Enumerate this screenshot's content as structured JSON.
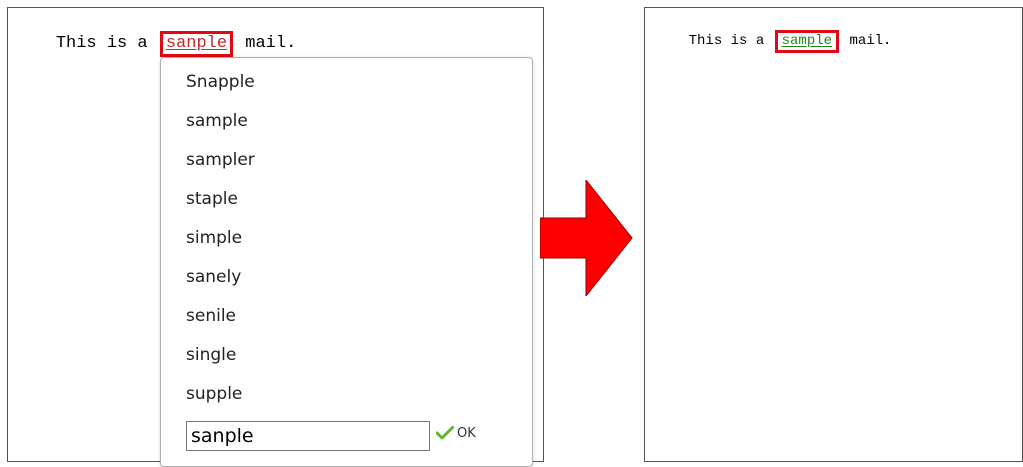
{
  "left_editor": {
    "text_before": "This is a",
    "misspelled_word": "sanple",
    "text_after": "mail."
  },
  "spellcheck_popup": {
    "suggestions": [
      "Snapple",
      "sample",
      "sampler",
      "staple",
      "simple",
      "sanely",
      "senile",
      "single",
      "supple"
    ],
    "edit_value": "sanple",
    "ok_label": "OK",
    "ok_icon": "checkmark-icon"
  },
  "right_editor": {
    "text_before": "This is a",
    "corrected_word": "sample",
    "text_after": "mail."
  },
  "colors": {
    "highlight_box": "#e30613",
    "arrow": "#ff0000",
    "misspelled_text": "#c0282e",
    "corrected_text": "#1a8a1a",
    "checkmark": "#5cb82c"
  }
}
